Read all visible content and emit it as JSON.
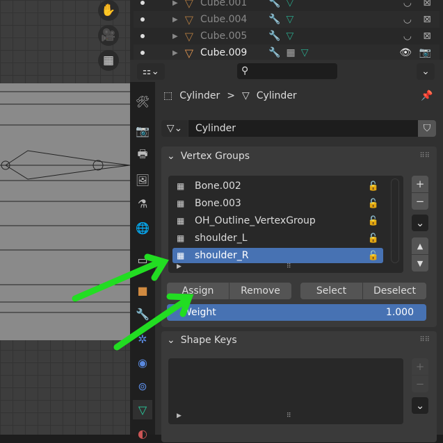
{
  "viewport": {
    "tools": [
      "hand-icon",
      "camera-icon",
      "grid-icon"
    ]
  },
  "outliner": {
    "rows": [
      {
        "name": "Cube.001",
        "active": false
      },
      {
        "name": "Cube.004",
        "active": false
      },
      {
        "name": "Cube.005",
        "active": false
      },
      {
        "name": "Cube.009",
        "active": true
      }
    ]
  },
  "properties": {
    "search_placeholder": "",
    "breadcrumb": {
      "object": "Cylinder",
      "separator": ">",
      "data": "Cylinder"
    },
    "mesh_name": "Cylinder",
    "vertex_groups": {
      "title": "Vertex Groups",
      "items": [
        "Bone.002",
        "Bone.003",
        "OH_Outline_VertexGroup",
        "shoulder_L",
        "shoulder_R"
      ],
      "selected": "shoulder_R",
      "buttons": {
        "assign": "Assign",
        "remove": "Remove",
        "select": "Select",
        "deselect": "Deselect"
      },
      "weight_label": "Weight",
      "weight_value": "1.000"
    },
    "shape_keys": {
      "title": "Shape Keys"
    }
  },
  "annotations": {
    "arrow_color": "#22dd22"
  },
  "colors": {
    "accent": "#4772b3"
  }
}
